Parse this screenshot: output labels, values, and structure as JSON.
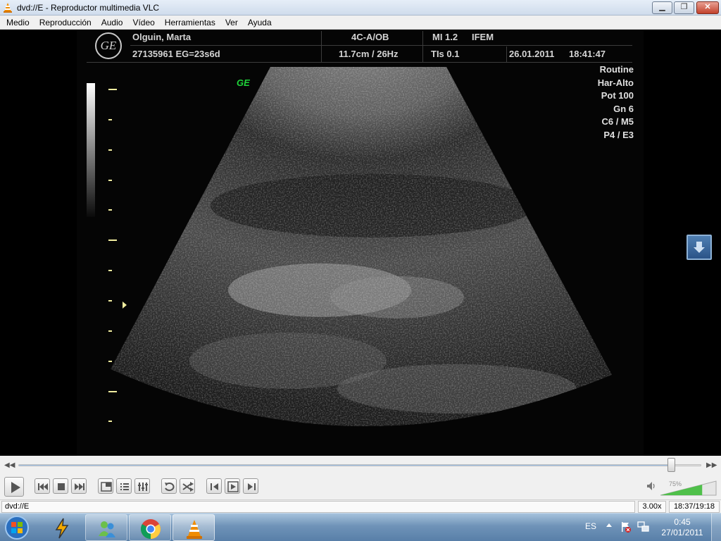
{
  "window": {
    "title": "dvd://E - Reproductor multimedia VLC",
    "app_icon": "vlc-cone-icon",
    "buttons": [
      "minimize-icon",
      "maximize-icon",
      "close-icon"
    ]
  },
  "menu": [
    "Medio",
    "Reproducción",
    "Audio",
    "Vídeo",
    "Herramientas",
    "Ver",
    "Ayuda"
  ],
  "ultrasound": {
    "patient_name": "Olguin, Marta",
    "patient_id": "27135961 EG=23s6d",
    "probe": "4C-A/OB",
    "depth_freq": "11.7cm / 26Hz",
    "mi": "MI  1.2",
    "ifem": "IFEM",
    "tis": "TIs  0.1",
    "date": "26.01.2011",
    "time": "18:41:47",
    "ge_tag": "GE",
    "params": [
      "Routine",
      "Har-Alto",
      "Pot 100",
      "Gn   6",
      "C6 / M5",
      "P4 / E3"
    ],
    "colors": {
      "overlay_text": "#d4d4d4",
      "ge_tag": "#1fd43a",
      "depth_marks": "#f2eea0"
    }
  },
  "controls": {
    "seek_position": 0.957,
    "buttons": [
      "play-icon",
      "previous-icon",
      "stop-icon",
      "next-icon",
      "fullscreen-icon",
      "playlist-icon",
      "extended-settings-icon",
      "loop-icon",
      "random-icon",
      "frame-back-icon",
      "snapshot-icon",
      "frame-forward-icon"
    ],
    "volume_label": "75%",
    "volume_level": 0.75
  },
  "status": {
    "path": "dvd://E",
    "speed": "3.00x",
    "time": "18:37/19:18"
  },
  "taskbar": {
    "apps": [
      "start-orb-icon",
      "winamp-icon",
      "messenger-icon",
      "chrome-icon",
      "vlc-icon"
    ],
    "language": "ES",
    "clock_time": "0:45",
    "clock_date": "27/01/2011",
    "colors": {
      "taskbar": "#6f93b8"
    }
  }
}
